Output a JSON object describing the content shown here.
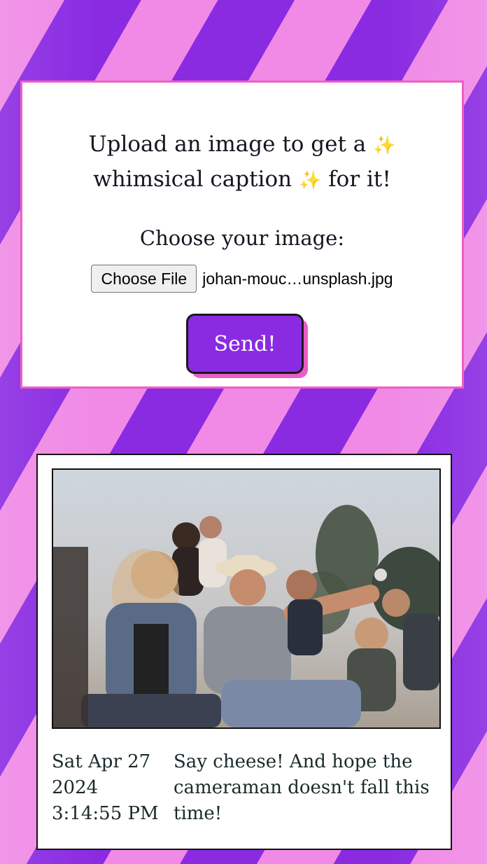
{
  "upload": {
    "title_line1": "Upload an image to get a",
    "title_line2_a": "whimsical caption",
    "title_line2_b": "for it!",
    "sparkle": "✨",
    "choose_label": "Choose your image:",
    "file_button_label": "Choose File",
    "file_name": "johan-mouc…unsplash.jpg",
    "send_label": "Send!"
  },
  "result": {
    "timestamp": "Sat Apr 27 2024 3:14:55 PM",
    "caption": "Say cheese! And hope the cameraman doesn't fall this time!"
  },
  "colors": {
    "accent_purple": "#8a2be2",
    "accent_pink": "#f05fc0",
    "stripe_light": "#f08ae6"
  }
}
